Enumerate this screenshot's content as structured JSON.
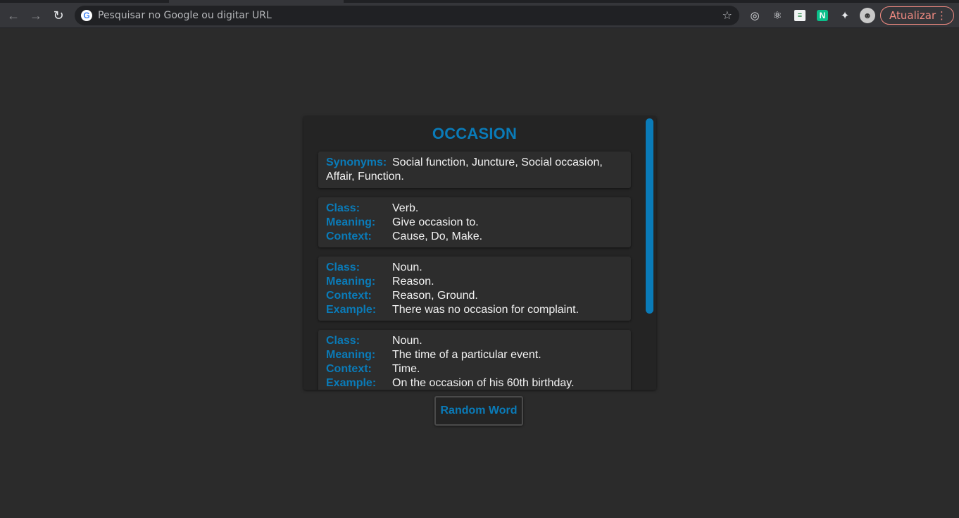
{
  "browser": {
    "omnibox_placeholder": "Pesquisar no Google ou digitar URL",
    "google_glyph": "G",
    "update_label": "Atualizar",
    "extensions": [
      "target-icon",
      "react-icon",
      "sheet-icon",
      "notion-icon",
      "puzzle-icon",
      "profile-avatar"
    ],
    "notion_glyph": "N"
  },
  "word": {
    "title": "OCCASION",
    "synonyms_label": "Synonyms:",
    "synonyms_value": "Social function, Juncture, Social occasion, Affair, Function.",
    "senses": [
      {
        "class_label": "Class:",
        "class_value": "Verb.",
        "meaning_label": "Meaning:",
        "meaning_value": "Give occasion to.",
        "context_label": "Context:",
        "context_value": "Cause, Do, Make."
      },
      {
        "class_label": "Class:",
        "class_value": "Noun.",
        "meaning_label": "Meaning:",
        "meaning_value": "Reason.",
        "context_label": "Context:",
        "context_value": "Reason, Ground.",
        "example_label": "Example:",
        "example_value": "There was no occasion for complaint."
      },
      {
        "class_label": "Class:",
        "class_value": "Noun.",
        "meaning_label": "Meaning:",
        "meaning_value": "The time of a particular event.",
        "context_label": "Context:",
        "context_value": "Time.",
        "example_label": "Example:",
        "example_value": "On the occasion of his 60th birthday."
      }
    ]
  },
  "actions": {
    "random_word_label": "Random Word"
  },
  "colors": {
    "accent": "#0a7bb8",
    "page_bg": "#2b2b2b",
    "card_bg": "#242424",
    "box_bg": "#2d2d2d",
    "update_red": "#f28b82"
  }
}
